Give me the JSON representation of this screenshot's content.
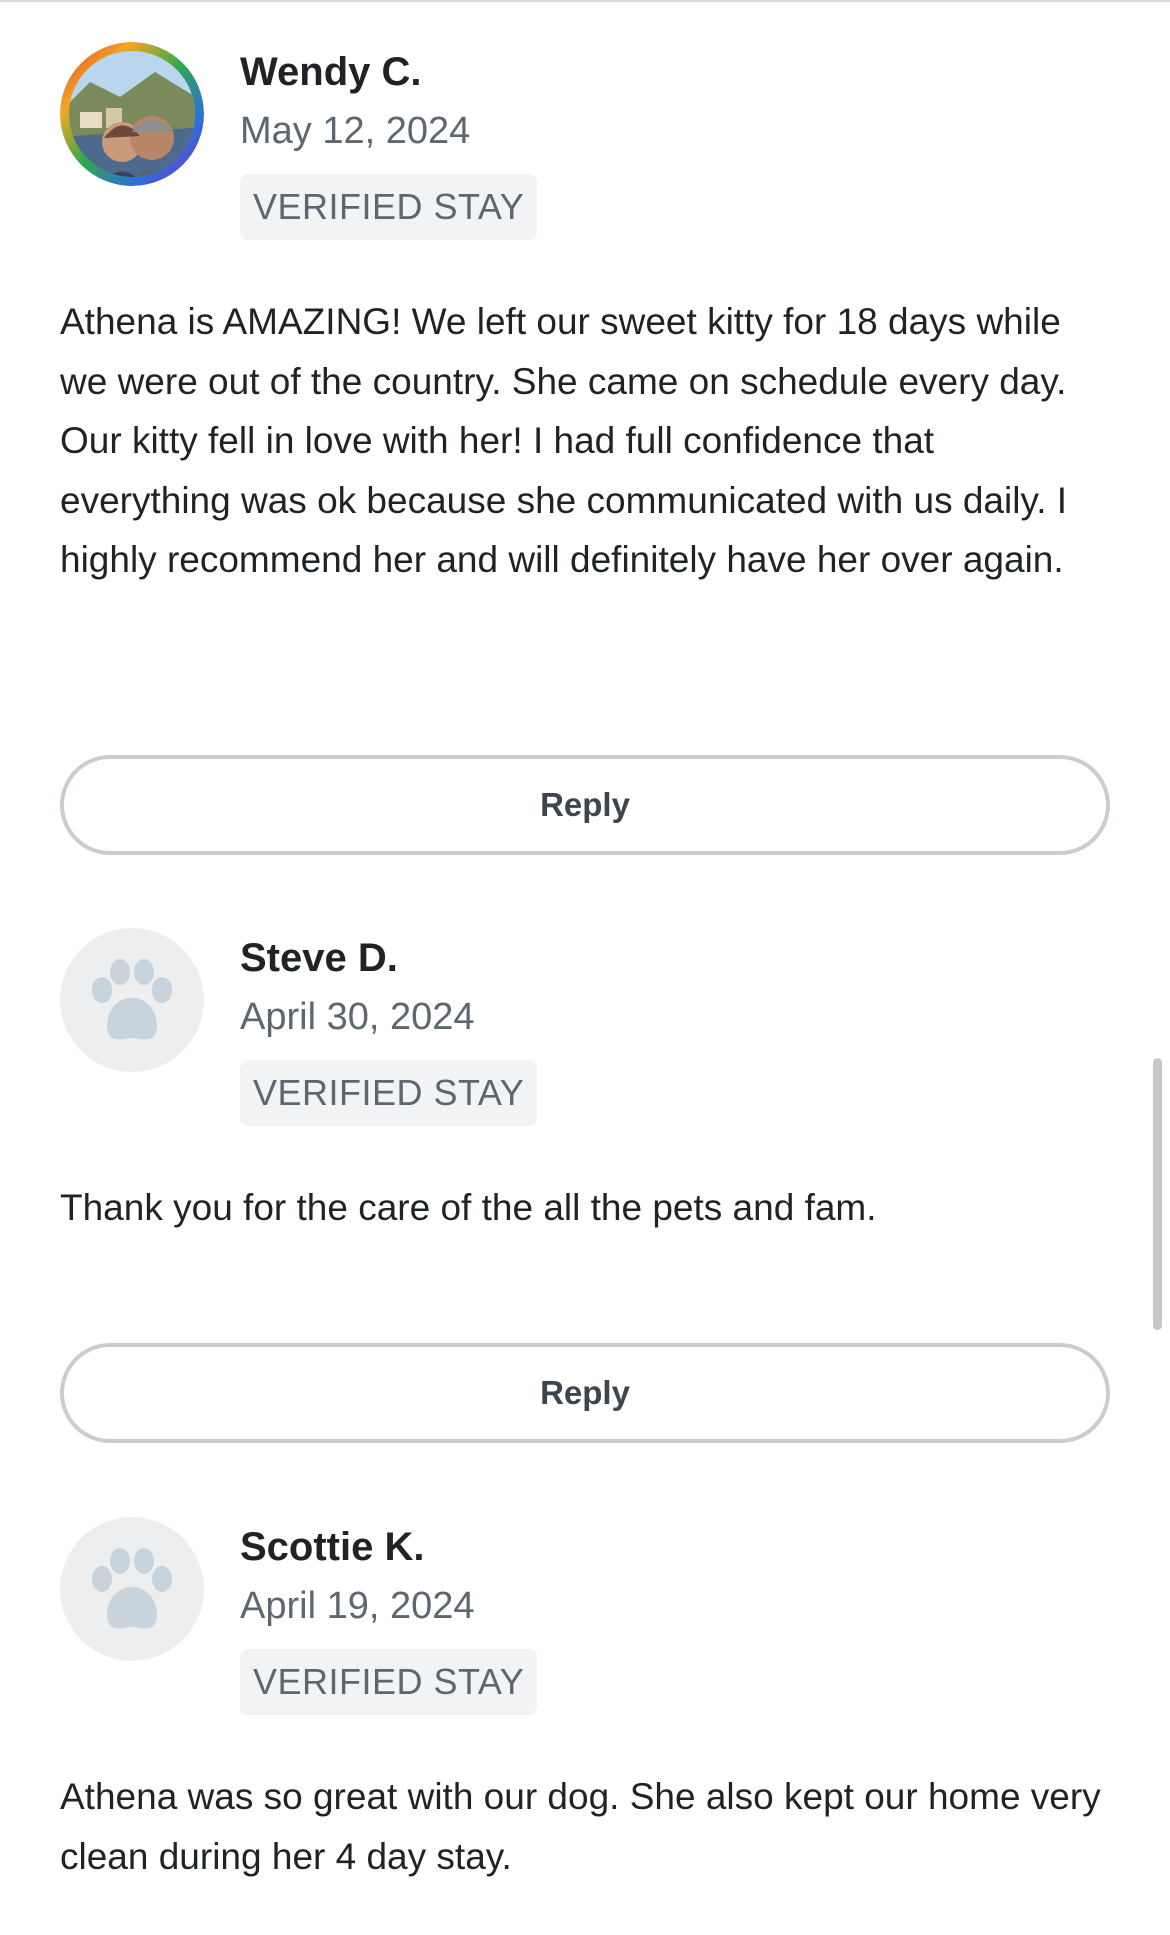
{
  "reviews": [
    {
      "name": "Wendy C.",
      "date": "May 12, 2024",
      "badge": "VERIFIED STAY",
      "text": "Athena is AMAZING! We left our sweet kitty for 18 days while we were out of the country. She came on schedule every day. Our kitty fell in love with her! I had full confidence that everything was ok because she communicated with us daily. I highly recommend her and will definitely have her over again.",
      "reply_label": "Reply",
      "avatar": "photo"
    },
    {
      "name": "Steve D.",
      "date": "April 30, 2024",
      "badge": "VERIFIED STAY",
      "text": "Thank you for the care of the all the pets and fam.",
      "reply_label": "Reply",
      "avatar": "paw-icon"
    },
    {
      "name": "Scottie K.",
      "date": "April 19, 2024",
      "badge": "VERIFIED STAY",
      "text": "Athena was so great with our dog. She also kept our home very clean during her 4 day stay.",
      "avatar": "paw-icon"
    }
  ],
  "colors": {
    "text": "#1f2326",
    "muted": "#5e6670",
    "badge_bg": "#f2f3f5",
    "button_border": "#c9cdd2",
    "avatar_bg": "#eceef0",
    "paw": "#c8d3db"
  }
}
